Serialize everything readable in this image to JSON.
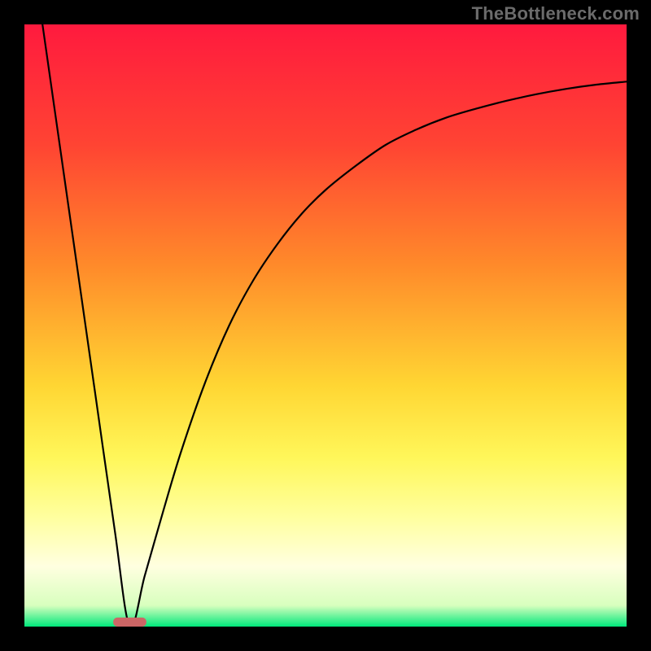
{
  "watermark": "TheBottleneck.com",
  "chart_data": {
    "type": "line",
    "title": "",
    "xlabel": "",
    "ylabel": "",
    "xlim": [
      0,
      100
    ],
    "ylim": [
      0,
      100
    ],
    "background_gradient": {
      "stops": [
        {
          "offset": 0.0,
          "color": "#ff1a3e"
        },
        {
          "offset": 0.2,
          "color": "#ff4433"
        },
        {
          "offset": 0.4,
          "color": "#ff8a2a"
        },
        {
          "offset": 0.6,
          "color": "#ffd633"
        },
        {
          "offset": 0.72,
          "color": "#fff75a"
        },
        {
          "offset": 0.82,
          "color": "#ffffa0"
        },
        {
          "offset": 0.9,
          "color": "#ffffe0"
        },
        {
          "offset": 0.965,
          "color": "#d8ffbe"
        },
        {
          "offset": 1.0,
          "color": "#00e87b"
        }
      ]
    },
    "curve": {
      "comment": "Bottleneck-style curve: steep descent from top-left to a minimum near x≈0.17, then asymptotic rise toward top-right.",
      "x": [
        0.03,
        0.06,
        0.09,
        0.12,
        0.15,
        0.175,
        0.2,
        0.23,
        0.26,
        0.3,
        0.34,
        0.38,
        0.42,
        0.46,
        0.5,
        0.55,
        0.6,
        0.65,
        0.7,
        0.75,
        0.8,
        0.85,
        0.9,
        0.95,
        1.0
      ],
      "y": [
        1.0,
        0.79,
        0.58,
        0.37,
        0.16,
        0.0,
        0.085,
        0.19,
        0.29,
        0.405,
        0.5,
        0.575,
        0.635,
        0.685,
        0.725,
        0.765,
        0.8,
        0.825,
        0.845,
        0.86,
        0.873,
        0.884,
        0.893,
        0.9,
        0.905
      ]
    },
    "marker": {
      "x": 0.175,
      "y": 0.0,
      "width_frac": 0.055,
      "height_frac": 0.015,
      "color": "#cc6666"
    }
  }
}
